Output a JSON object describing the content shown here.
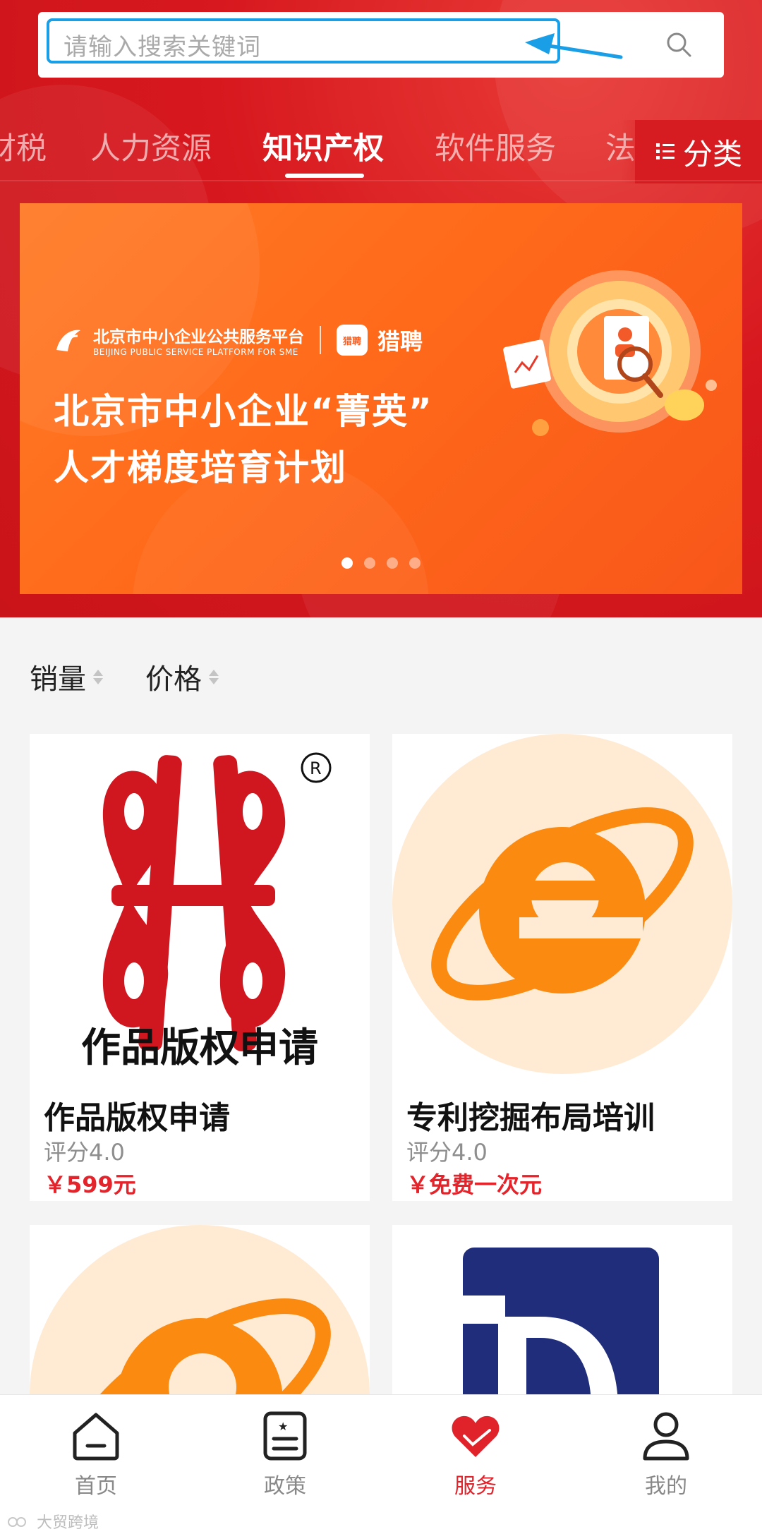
{
  "search": {
    "placeholder": "请输入搜索关键词"
  },
  "tabs": [
    {
      "label": "财税"
    },
    {
      "label": "人力资源"
    },
    {
      "label": "知识产权",
      "active": true
    },
    {
      "label": "软件服务"
    },
    {
      "label": "法"
    }
  ],
  "category_button": {
    "label": "分类",
    "icon": "grid-list-icon"
  },
  "banner": {
    "org_name": "北京市中小企业公共服务平台",
    "org_name_en": "BEIJING PUBLIC SERVICE PLATFORM FOR SME",
    "partner_badge": "猎聘",
    "partner_name": "猎聘",
    "title_line1": "北京市中小企业“菁英”",
    "title_line2": "人才梯度培育计划",
    "page_count": 4,
    "active_page": 1
  },
  "sort": {
    "sales": "销量",
    "price": "价格"
  },
  "products": [
    {
      "title": "作品版权申请",
      "image_caption": "作品版权申请",
      "rating": "评分4.0",
      "price": "￥599元",
      "image": "copyright-logo"
    },
    {
      "title": "专利挖掘布局培训",
      "rating": "评分4.0",
      "price": "￥免费一次元",
      "image": "e-logo"
    },
    {
      "title": "",
      "image": "e-logo"
    },
    {
      "title": "",
      "image": "d-logo"
    }
  ],
  "tabbar": [
    {
      "label": "首页",
      "icon": "home-icon"
    },
    {
      "label": "政策",
      "icon": "policy-document-icon"
    },
    {
      "label": "服务",
      "icon": "heart-hand-icon",
      "active": true
    },
    {
      "label": "我的",
      "icon": "user-icon"
    }
  ],
  "watermark": "大贸跨境",
  "colors": {
    "brand_red": "#d61c20",
    "price_red": "#e4232a",
    "banner_orange": "#ff6a1a",
    "highlight_blue": "#1a9fe6"
  }
}
